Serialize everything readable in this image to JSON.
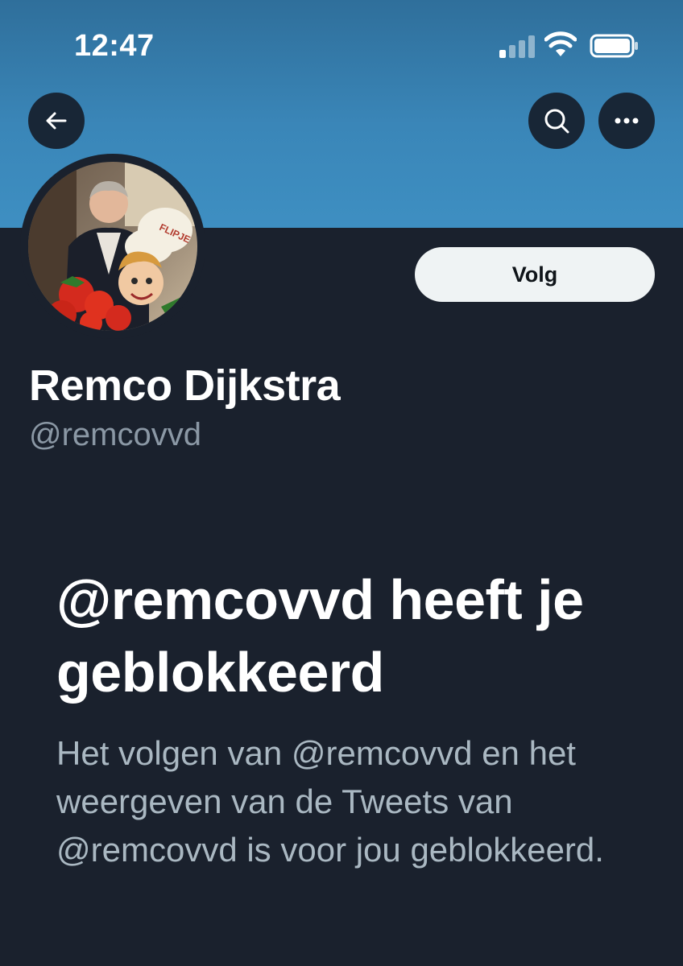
{
  "status_bar": {
    "time": "12:47"
  },
  "icons": {
    "back": "arrow-left-icon",
    "search": "search-icon",
    "more": "more-horizontal-icon",
    "signal": "cellular-signal-icon",
    "wifi": "wifi-icon",
    "battery": "battery-icon"
  },
  "colors": {
    "banner": "#3a86b8",
    "background": "#1a212d",
    "follow_button_bg": "#eff3f4",
    "secondary_text": "#8b98a5"
  },
  "profile": {
    "display_name": "Remco Dijkstra",
    "handle": "@remcovvd",
    "follow_label": "Volg",
    "avatar_caption": "FLIPJE"
  },
  "blocked": {
    "title": "@remcovvd heeft je geblokkeerd",
    "description": "Het volgen van @remcovvd en het weergeven van de Tweets van @remcovvd is voor jou geblokkeerd."
  }
}
